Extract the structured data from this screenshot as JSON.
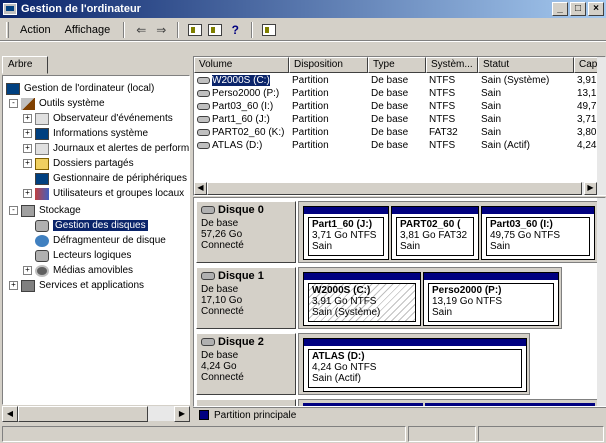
{
  "window": {
    "title": "Gestion de l'ordinateur",
    "controls": [
      "_",
      "□",
      "×"
    ]
  },
  "menu": {
    "action": "Action",
    "view": "Affichage",
    "back_icon": "arrow-left-icon",
    "forward_icon": "arrow-right-icon"
  },
  "left_pane": {
    "tab_label": "Arbre",
    "tree": [
      {
        "label": "Gestion de l'ordinateur (local)",
        "icon": "computer-icon",
        "expander": ""
      },
      {
        "label": "Outils système",
        "icon": "tools-icon",
        "expander": "-"
      },
      {
        "label": "Observateur d'événements",
        "icon": "event-viewer-icon",
        "expander": "+"
      },
      {
        "label": "Informations système",
        "icon": "info-icon",
        "expander": "+"
      },
      {
        "label": "Journaux et alertes de performance",
        "icon": "log-icon",
        "expander": "+"
      },
      {
        "label": "Dossiers partagés",
        "icon": "folder-icon",
        "expander": "+"
      },
      {
        "label": "Gestionnaire de périphériques",
        "icon": "device-icon",
        "expander": ""
      },
      {
        "label": "Utilisateurs et groupes locaux",
        "icon": "users-icon",
        "expander": "+"
      },
      {
        "label": "Stockage",
        "icon": "storage-icon",
        "expander": "-"
      },
      {
        "label": "Gestion des disques",
        "icon": "disk-icon",
        "expander": ""
      },
      {
        "label": "Défragmenteur de disque",
        "icon": "defrag-icon",
        "expander": ""
      },
      {
        "label": "Lecteurs logiques",
        "icon": "drive-icon",
        "expander": ""
      },
      {
        "label": "Médias amovibles",
        "icon": "media-icon",
        "expander": "+"
      },
      {
        "label": "Services et applications",
        "icon": "services-icon",
        "expander": "+"
      }
    ]
  },
  "volume_list": {
    "headers": [
      "Volume",
      "Disposition",
      "Type",
      "Systèm...",
      "Statut",
      "Cap"
    ],
    "rows": [
      [
        "W2000S (C:)",
        "Partition",
        "De base",
        "NTFS",
        "Sain (Système)",
        "3,91"
      ],
      [
        "Perso2000 (P:)",
        "Partition",
        "De base",
        "NTFS",
        "Sain",
        "13,1"
      ],
      [
        "Part03_60 (I:)",
        "Partition",
        "De base",
        "NTFS",
        "Sain",
        "49,7"
      ],
      [
        "Part1_60 (J:)",
        "Partition",
        "De base",
        "NTFS",
        "Sain",
        "3,71"
      ],
      [
        "PART02_60 (K:)",
        "Partition",
        "De base",
        "FAT32",
        "Sain",
        "3,80"
      ],
      [
        "ATLAS (D:)",
        "Partition",
        "De base",
        "NTFS",
        "Sain (Actif)",
        "4,24"
      ]
    ]
  },
  "disks": [
    {
      "name": "Disque 0",
      "type": "De base",
      "size": "57,26 Go",
      "state": "Connecté",
      "partitions": [
        {
          "name": "Part1_60  (J:)",
          "size": "3,71 Go NTFS",
          "status": "Sain"
        },
        {
          "name": "PART02_60  (",
          "size": "3,81 Go FAT32",
          "status": "Sain"
        },
        {
          "name": "Part03_60  (I:)",
          "size": "49,75 Go NTFS",
          "status": "Sain"
        }
      ]
    },
    {
      "name": "Disque 1",
      "type": "De base",
      "size": "17,10 Go",
      "state": "Connecté",
      "partitions": [
        {
          "name": "W2000S  (C:)",
          "size": "3,91 Go NTFS",
          "status": "Sain (Système)"
        },
        {
          "name": "Perso2000  (P:)",
          "size": "13,19 Go NTFS",
          "status": "Sain"
        }
      ]
    },
    {
      "name": "Disque 2",
      "type": "De base",
      "size": "4,24 Go",
      "state": "Connecté",
      "partitions": [
        {
          "name": "ATLAS  (D:)",
          "size": "4,24 Go NTFS",
          "status": "Sain (Actif)"
        }
      ]
    }
  ],
  "legend": {
    "label": "Partition principale",
    "color": "#000080"
  }
}
